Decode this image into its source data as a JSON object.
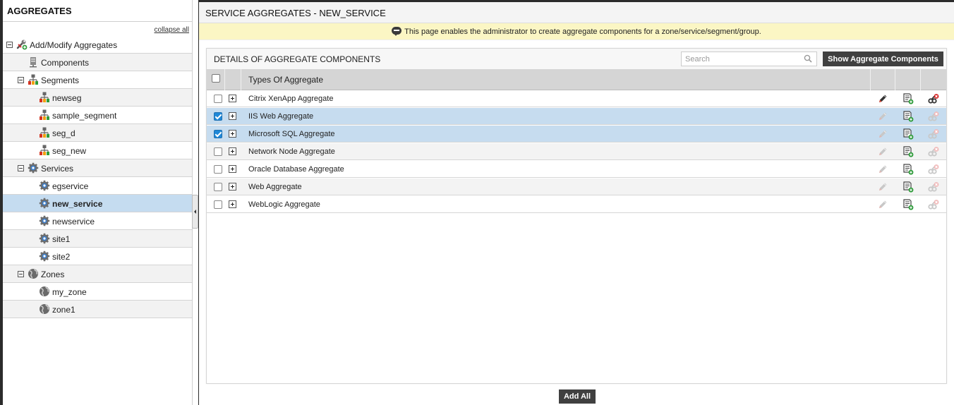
{
  "sidebar": {
    "title": "AGGREGATES",
    "collapse_label": "collapse all",
    "root_label": "Add/Modify Aggregates",
    "components_label": "Components",
    "segments": {
      "label": "Segments",
      "items": [
        "newseg",
        "sample_segment",
        "seg_d",
        "seg_new"
      ]
    },
    "services": {
      "label": "Services",
      "items": [
        "egservice",
        "new_service",
        "newservice",
        "site1",
        "site2"
      ],
      "selected": "new_service"
    },
    "zones": {
      "label": "Zones",
      "items": [
        "my_zone",
        "zone1"
      ]
    }
  },
  "main": {
    "title": "SERVICE AGGREGATES - NEW_SERVICE",
    "info": "This page enables the administrator to create aggregate components for a zone/service/segment/group.",
    "panel_title": "DETAILS OF AGGREGATE COMPONENTS",
    "search_placeholder": "Search",
    "show_button": "Show Aggregate Components",
    "column_header": "Types Of Aggregate",
    "rows": [
      {
        "name": "Citrix XenApp Aggregate",
        "checked": false,
        "active": true
      },
      {
        "name": "IIS Web Aggregate",
        "checked": true,
        "active": false
      },
      {
        "name": "Microsoft SQL Aggregate",
        "checked": true,
        "active": false
      },
      {
        "name": "Network Node Aggregate",
        "checked": false,
        "active": false
      },
      {
        "name": "Oracle Database Aggregate",
        "checked": false,
        "active": false
      },
      {
        "name": "Web Aggregate",
        "checked": false,
        "active": false
      },
      {
        "name": "WebLogic Aggregate",
        "checked": false,
        "active": false
      }
    ],
    "add_all_label": "Add All"
  },
  "colors": {
    "selected_row": "#c5dcf0",
    "info_bar": "#fbf6c4",
    "button_dark": "#404040",
    "checkbox_blue": "#1e88d8"
  },
  "icons": {
    "root": "wrench-plus-icon",
    "components": "server-icon",
    "segment": "network-tree-icon",
    "service": "gear-icon",
    "zone": "globe-icon",
    "search": "magnifier-icon",
    "edit": "pencil-icon",
    "add_component": "document-plus-icon",
    "delete": "link-delete-icon",
    "info": "speech-bubble-icon"
  }
}
